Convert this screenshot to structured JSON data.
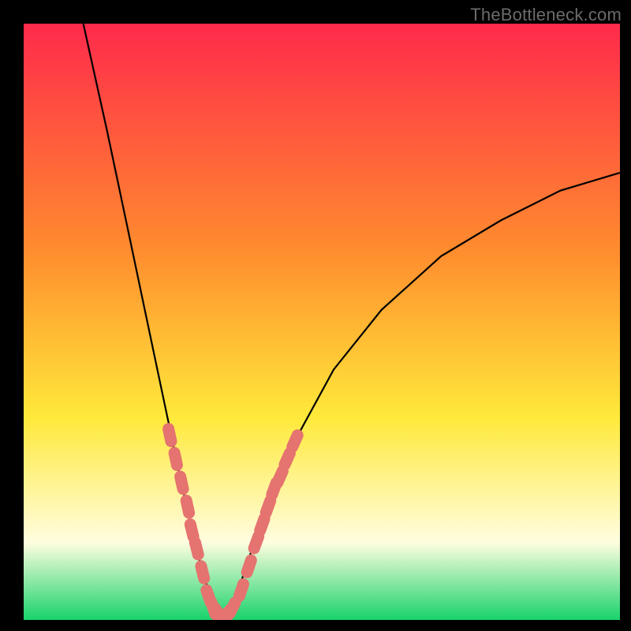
{
  "watermark": "TheBottleneck.com",
  "colors": {
    "bg_black": "#000000",
    "gradient_top": "#ff2a4b",
    "gradient_mid1": "#ff8c2e",
    "gradient_mid2": "#ffe93a",
    "gradient_mid3": "#fffde0",
    "gradient_bottom": "#18d36b",
    "curve": "#000000",
    "marker_fill": "#e5736f",
    "marker_stroke": "#cf5a57",
    "watermark": "#6b6b6b"
  },
  "chart_data": {
    "type": "line",
    "title": "",
    "xlabel": "",
    "ylabel": "",
    "xlim": [
      0,
      100
    ],
    "ylim": [
      0,
      100
    ],
    "grid": false,
    "legend": false,
    "note": "No axis ticks or numeric labels are visible; y appears to represent bottleneck % (0 at bottom, ~100 at top). V-shaped curve with minimum near x≈33. Values estimated from curve position relative to plot height.",
    "series": [
      {
        "name": "bottleneck-curve",
        "x": [
          10,
          14,
          18,
          22,
          26,
          28,
          30,
          32,
          33,
          34,
          36,
          38,
          42,
          46,
          52,
          60,
          70,
          80,
          90,
          100
        ],
        "y": [
          100,
          82,
          63,
          44,
          25,
          16,
          8,
          2,
          0,
          1,
          5,
          11,
          22,
          31,
          42,
          52,
          61,
          67,
          72,
          75
        ]
      }
    ],
    "markers": {
      "name": "highlighted-points",
      "note": "Salmon dot/segment markers clustered on both arms of the V near the bottom ~30% of the plot.",
      "x": [
        24.5,
        25.5,
        26.5,
        27.5,
        28.2,
        29.0,
        30.0,
        31.0,
        31.8,
        32.6,
        33.4,
        34.2,
        35.0,
        36.5,
        37.8,
        39.0,
        40.0,
        41.0,
        42.0,
        43.0,
        44.2,
        45.5
      ],
      "y": [
        31,
        27,
        23,
        19,
        15,
        12,
        8,
        4,
        2,
        1,
        0.5,
        0.8,
        2,
        5,
        9,
        13,
        16,
        19,
        22,
        24,
        27,
        30
      ]
    }
  }
}
